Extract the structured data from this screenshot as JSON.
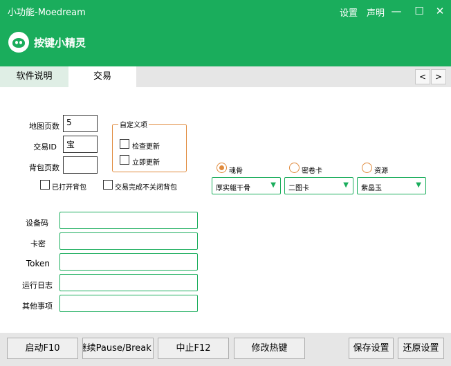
{
  "titlebar": {
    "title": "小功能-Moedream",
    "settings": "设置",
    "statement": "声明",
    "min_glyph": "—",
    "max_glyph": "☐",
    "close_glyph": "✕"
  },
  "banner": {
    "brand": "按键小精灵"
  },
  "tabs": [
    {
      "label": "软件说明"
    },
    {
      "label": "交易"
    }
  ],
  "tab_nav": {
    "prev": "<",
    "next": ">"
  },
  "form": {
    "map_pages_label": "地图页数",
    "map_pages_value": "5",
    "trade_id_label": "交易ID",
    "trade_id_value": "宝",
    "bag_pages_label": "背包页数",
    "bag_pages_value": "",
    "bag_opened_label": "已打开背包",
    "keep_bag_label": "交易完成不关闭背包"
  },
  "custom_group": {
    "title": "自定义项",
    "check_update": "检查更新",
    "update_now": "立即更新"
  },
  "radios": [
    {
      "label": "魂骨",
      "checked": true
    },
    {
      "label": "密卷卡",
      "checked": false
    },
    {
      "label": "资源",
      "checked": false
    }
  ],
  "combos": [
    {
      "value": "厚实躯干骨"
    },
    {
      "value": "二图卡"
    },
    {
      "value": "紫晶玉"
    }
  ],
  "info": {
    "device_code": "设备码",
    "card_key": "卡密",
    "token": "Token",
    "run_log": "运行日志",
    "other": "其他事项"
  },
  "buttons": {
    "start": "启动F10",
    "pause": "暂停/继续Pause/Break",
    "stop": "中止F12",
    "hotkey": "修改热键",
    "save": "保存设置",
    "restore": "还原设置"
  },
  "colors": {
    "accent": "#1aad5c",
    "orange": "#e08a3c"
  }
}
